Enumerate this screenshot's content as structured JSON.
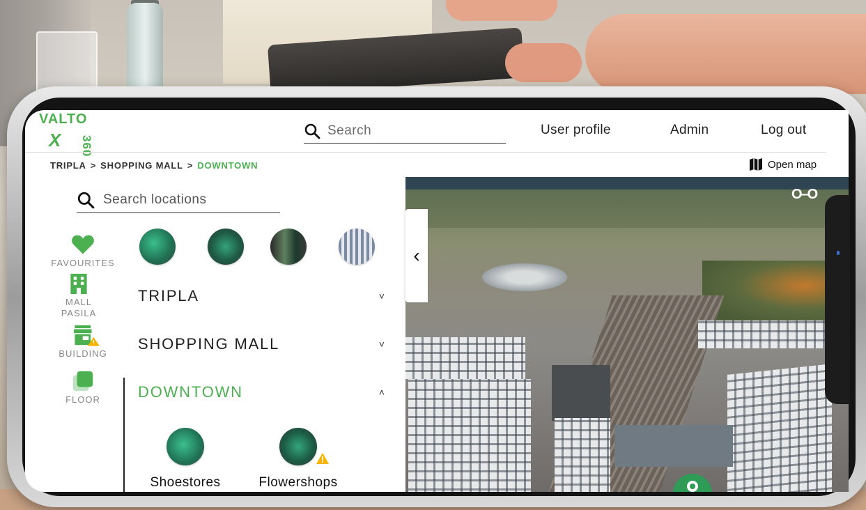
{
  "header": {
    "logo_text": "VALTO",
    "logo_mark": "X",
    "logo_number": "360",
    "search_placeholder": "Search",
    "nav": [
      {
        "label": "User profile"
      },
      {
        "label": "Admin"
      },
      {
        "label": "Log out"
      }
    ]
  },
  "breadcrumb": {
    "items": [
      "TRIPLA",
      "SHOPPING MALL",
      "DOWNTOWN"
    ],
    "separator": ">"
  },
  "open_map_label": "Open map",
  "location_search_placeholder": "Search locations",
  "sidebar": {
    "items": [
      {
        "label": "FAVOURITES",
        "icon": "heart-icon"
      },
      {
        "label": "MALL PASILA",
        "icon": "building-icon"
      },
      {
        "label": "BUILDING",
        "icon": "store-warning-icon"
      },
      {
        "label": "FLOOR",
        "icon": "layers-icon"
      }
    ]
  },
  "groups": [
    {
      "label": "TRIPLA",
      "chevron": "˅",
      "expanded": false
    },
    {
      "label": "SHOPPING MALL",
      "chevron": "˅",
      "expanded": false
    },
    {
      "label": "DOWNTOWN",
      "chevron": "˄",
      "expanded": true
    }
  ],
  "locations": [
    {
      "name": "Shoestores",
      "warning": false
    },
    {
      "name": "Flowershops",
      "warning": true
    }
  ],
  "colors": {
    "accent": "#4caf50",
    "warning": "#f4b400",
    "text": "#222222",
    "muted": "#888888"
  }
}
